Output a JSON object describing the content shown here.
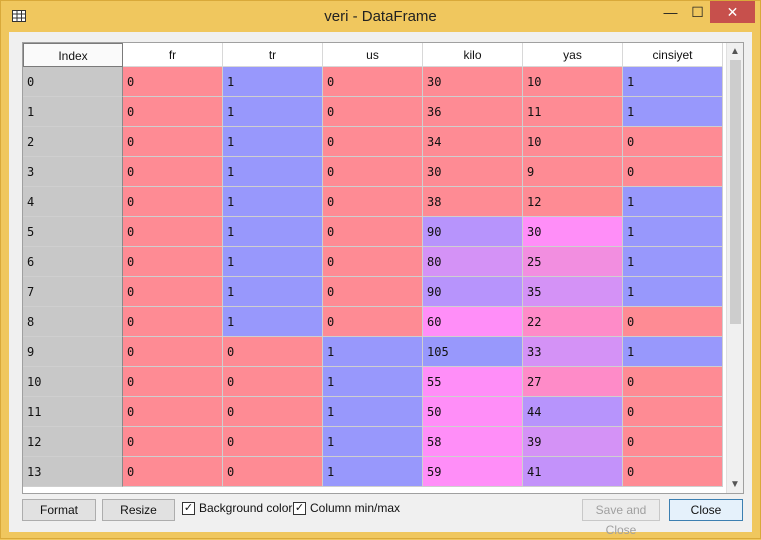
{
  "window": {
    "title": "veri - DataFrame",
    "minimize_glyph": "—",
    "maximize_glyph": "☐",
    "close_glyph": "✕",
    "icon": "table-icon"
  },
  "table": {
    "columns": [
      "Index",
      "fr",
      "tr",
      "us",
      "kilo",
      "yas",
      "cinsiyet"
    ],
    "rows": [
      [
        "0",
        "0",
        "1",
        "0",
        "30",
        "10",
        "1"
      ],
      [
        "1",
        "0",
        "1",
        "0",
        "36",
        "11",
        "1"
      ],
      [
        "2",
        "0",
        "1",
        "0",
        "34",
        "10",
        "0"
      ],
      [
        "3",
        "0",
        "1",
        "0",
        "30",
        "9",
        "0"
      ],
      [
        "4",
        "0",
        "1",
        "0",
        "38",
        "12",
        "1"
      ],
      [
        "5",
        "0",
        "1",
        "0",
        "90",
        "30",
        "1"
      ],
      [
        "6",
        "0",
        "1",
        "0",
        "80",
        "25",
        "1"
      ],
      [
        "7",
        "0",
        "1",
        "0",
        "90",
        "35",
        "1"
      ],
      [
        "8",
        "0",
        "1",
        "0",
        "60",
        "22",
        "0"
      ],
      [
        "9",
        "0",
        "0",
        "1",
        "105",
        "33",
        "1"
      ],
      [
        "10",
        "0",
        "0",
        "1",
        "55",
        "27",
        "0"
      ],
      [
        "11",
        "0",
        "0",
        "1",
        "50",
        "44",
        "0"
      ],
      [
        "12",
        "0",
        "0",
        "1",
        "58",
        "39",
        "0"
      ],
      [
        "13",
        "0",
        "0",
        "1",
        "59",
        "41",
        "0"
      ]
    ],
    "cell_colors": [
      [
        "#fe8b94",
        "#9898fc",
        "#fe8b94",
        "#fe8b94",
        "#fe8b94",
        "#9898fc"
      ],
      [
        "#fe8b94",
        "#9898fc",
        "#fe8b94",
        "#fe8b94",
        "#fe8b94",
        "#9898fc"
      ],
      [
        "#fe8b94",
        "#9898fc",
        "#fe8b94",
        "#fe8b94",
        "#fe8b94",
        "#fe8b94"
      ],
      [
        "#fe8b94",
        "#9898fc",
        "#fe8b94",
        "#fe8b94",
        "#fe8b94",
        "#fe8b94"
      ],
      [
        "#fe8b94",
        "#9898fc",
        "#fe8b94",
        "#fe8b94",
        "#fe8b94",
        "#9898fc"
      ],
      [
        "#fe8b94",
        "#9898fc",
        "#fe8b94",
        "#b794fc",
        "#ff8ef8",
        "#9898fc"
      ],
      [
        "#fe8b94",
        "#9898fc",
        "#fe8b94",
        "#d492f6",
        "#f28ee0",
        "#9898fc"
      ],
      [
        "#fe8b94",
        "#9898fc",
        "#fe8b94",
        "#b794fc",
        "#d492f6",
        "#9898fc"
      ],
      [
        "#fe8b94",
        "#9898fc",
        "#fe8b94",
        "#ff8ef8",
        "#fe8bc8",
        "#fe8b94"
      ],
      [
        "#fe8b94",
        "#fe8b94",
        "#9898fc",
        "#9898fc",
        "#d492f6",
        "#9898fc"
      ],
      [
        "#fe8b94",
        "#fe8b94",
        "#9898fc",
        "#ff8ef8",
        "#fe8bc8",
        "#fe8b94"
      ],
      [
        "#fe8b94",
        "#fe8b94",
        "#9898fc",
        "#ff8ef8",
        "#b794fc",
        "#fe8b94"
      ],
      [
        "#fe8b94",
        "#fe8b94",
        "#9898fc",
        "#ff8ef8",
        "#d492f6",
        "#fe8b94"
      ],
      [
        "#fe8b94",
        "#fe8b94",
        "#9898fc",
        "#ff8ef8",
        "#c392fa",
        "#fe8b94"
      ]
    ],
    "index_color": "#c8c8c8"
  },
  "scrollbar": {
    "up_glyph": "▲",
    "down_glyph": "▼"
  },
  "buttons": {
    "format": "Format",
    "resize": "Resize",
    "background_color": "Background color",
    "background_color_checked": true,
    "column_minmax": "Column min/max",
    "column_minmax_checked": true,
    "save_and_close": "Save and Close",
    "close": "Close",
    "check_glyph": "✓"
  }
}
